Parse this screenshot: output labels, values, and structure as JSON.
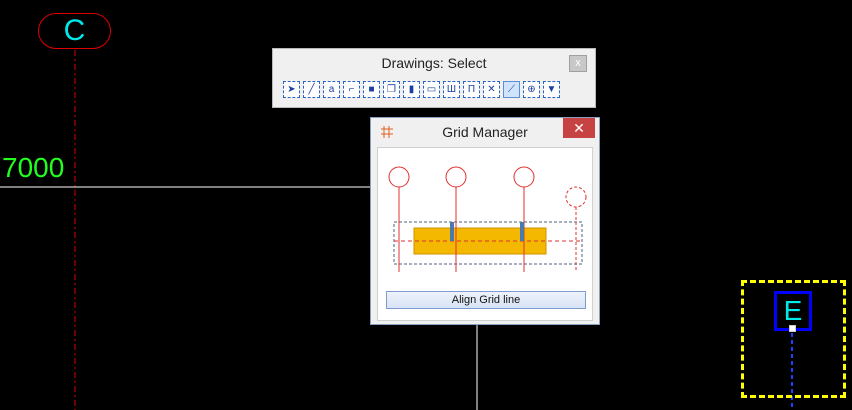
{
  "canvas": {
    "grid_c_label": "C",
    "grid_e_label": "E",
    "dimension_text": "7000",
    "colors": {
      "grid_line": "#e00000",
      "bubble_text": "#00e8e8",
      "dimension": "#20ff20",
      "selection": "#ffff00",
      "selected_bubble": "#0000ff"
    }
  },
  "toolbar": {
    "title": "Drawings: Select",
    "close_label": "x",
    "tools": [
      {
        "name": "select-arrow-icon",
        "glyph": "➤"
      },
      {
        "name": "draw-line-icon",
        "glyph": "╱"
      },
      {
        "name": "text-icon",
        "glyph": "a"
      },
      {
        "name": "polyline-icon",
        "glyph": "⌐"
      },
      {
        "name": "fill-icon",
        "glyph": "■"
      },
      {
        "name": "copy-icon",
        "glyph": "❐"
      },
      {
        "name": "pin-icon",
        "glyph": "▮"
      },
      {
        "name": "rectangle-icon",
        "glyph": "▭"
      },
      {
        "name": "dimension-icon",
        "glyph": "Ш"
      },
      {
        "name": "column-icon",
        "glyph": "Π"
      },
      {
        "name": "hatch-icon",
        "glyph": "✕"
      },
      {
        "name": "grid-select-icon",
        "glyph": "⟋",
        "active": true
      },
      {
        "name": "target-icon",
        "glyph": "⊕"
      },
      {
        "name": "marker-icon",
        "glyph": "▼"
      }
    ]
  },
  "grid_manager": {
    "title": "Grid Manager",
    "close_label": "✕",
    "align_button_label": "Align Grid line"
  }
}
